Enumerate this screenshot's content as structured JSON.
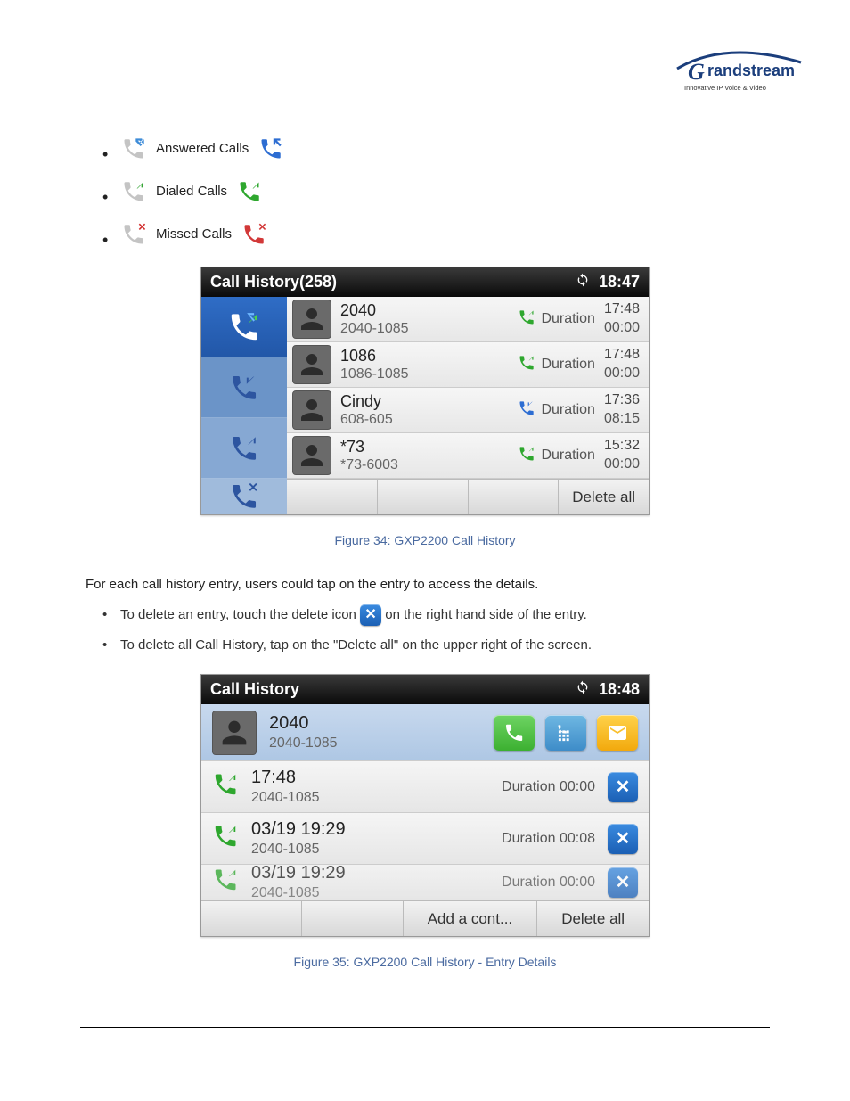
{
  "logo": {
    "brand": "Grandstream",
    "tagline": "Innovative IP Voice & Video"
  },
  "legend": {
    "answered": "Answered Calls",
    "dialed": "Dialed Calls",
    "missed": "Missed Calls"
  },
  "screenshot1": {
    "title": "Call History(258)",
    "clock": "18:47",
    "rows": [
      {
        "name": "2040",
        "sub": "2040-1085",
        "durLabel": "Duration",
        "time": "17:48",
        "dur": "00:00",
        "type": "dialed"
      },
      {
        "name": "1086",
        "sub": "1086-1085",
        "durLabel": "Duration",
        "time": "17:48",
        "dur": "00:00",
        "type": "dialed"
      },
      {
        "name": "Cindy",
        "sub": "608-605",
        "durLabel": "Duration",
        "time": "17:36",
        "dur": "08:15",
        "type": "answered"
      },
      {
        "name": "*73",
        "sub": "*73-6003",
        "durLabel": "Duration",
        "time": "15:32",
        "dur": "00:00",
        "type": "dialed"
      }
    ],
    "deleteAll": "Delete all"
  },
  "caption1": "Figure 34: GXP2200 Call History",
  "midText": "For each call history entry, users could tap on the entry to access the details.",
  "bullets2": {
    "b1_pre": "To delete an entry, touch the delete icon ",
    "b1_post": " on the right hand side of the entry.",
    "b2": "To delete all Call History, tap on the \"Delete all\" on the upper right of the screen."
  },
  "screenshot2": {
    "title": "Call History",
    "clock": "18:48",
    "contact": {
      "name": "2040",
      "sub": "2040-1085"
    },
    "rows": [
      {
        "ts": "17:48",
        "sub": "2040-1085",
        "durLabel": "Duration",
        "dur": "00:00",
        "type": "dialed"
      },
      {
        "ts": "03/19 19:29",
        "sub": "2040-1085",
        "durLabel": "Duration",
        "dur": "00:08",
        "type": "dialed"
      },
      {
        "ts": "03/19 19:29",
        "sub": "2040-1085",
        "durLabel": "Duration",
        "dur": "00:00",
        "type": "dialed"
      }
    ],
    "addContact": "Add a cont...",
    "deleteAll": "Delete all"
  },
  "caption2": "Figure 35: GXP2200 Call History - Entry Details"
}
